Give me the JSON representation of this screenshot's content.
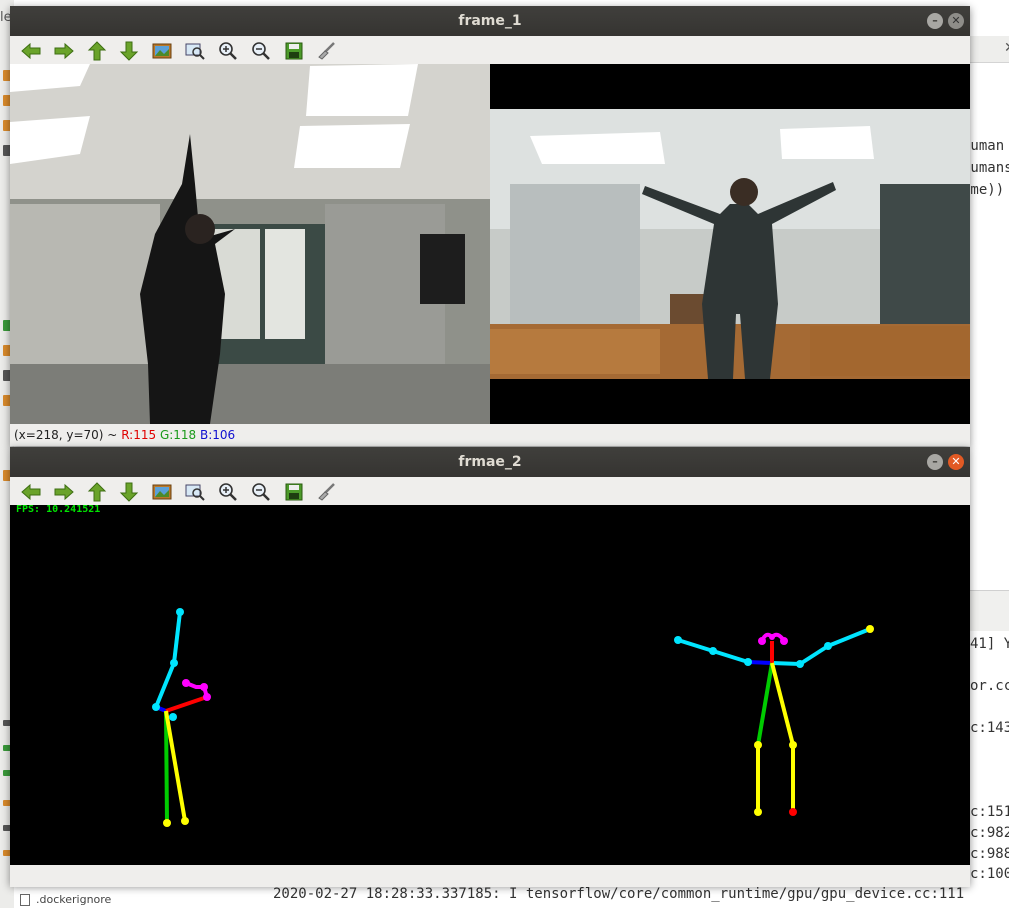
{
  "background_ide": {
    "top_left_text": "le",
    "code_lines": [
      "human",
      "humans",
      "ime))"
    ],
    "terminal_lines": [
      "41] Y",
      "or.cc",
      "c:143",
      "c:151",
      "c:982",
      "c:988",
      "c:100"
    ],
    "terminal_last_line": "2020-02-27 18:28:33.337185: I tensorflow/core/common_runtime/gpu/gpu_device.cc:111",
    "file_item": ".dockerignore",
    "tab_close": "✕"
  },
  "frame1": {
    "title": "frame_1",
    "tools": [
      "arrow-left",
      "arrow-right",
      "arrow-up",
      "arrow-down",
      "image",
      "zoom-fit",
      "zoom-in",
      "zoom-out",
      "save",
      "properties"
    ],
    "status": {
      "coords": "(x=218, y=70) ~",
      "r": "R:115",
      "g": "G:118",
      "b": "B:106"
    }
  },
  "frame2": {
    "title": "frmae_2",
    "fps_text": "FPS: 10.241521"
  },
  "colors": {
    "status_r": "#e00000",
    "status_g": "#1a9a1a",
    "status_b": "#1010d0",
    "fps": "#00e400"
  }
}
